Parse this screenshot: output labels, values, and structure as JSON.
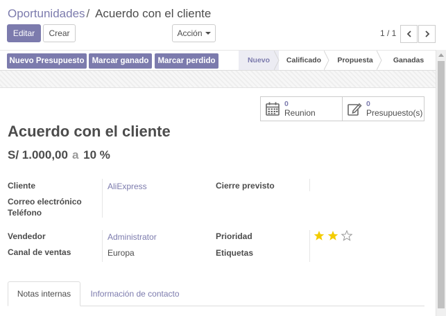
{
  "breadcrumb": {
    "parent": "Oportunidades",
    "separator": "/",
    "current": "Acuerdo con el cliente"
  },
  "toolbar": {
    "edit_label": "Editar",
    "create_label": "Crear",
    "action_label": "Acción"
  },
  "pager": {
    "value": "1 / 1"
  },
  "statusbar": {
    "buttons": [
      "Nuevo Presupuesto",
      "Marcar ganado",
      "Marcar perdido"
    ],
    "stages": [
      {
        "label": "Nuevo",
        "active": true
      },
      {
        "label": "Calificado",
        "active": false
      },
      {
        "label": "Propuesta",
        "active": false
      },
      {
        "label": "Ganadas",
        "active": false
      }
    ]
  },
  "smart_buttons": [
    {
      "count": "0",
      "label": "Reunion",
      "icon": "calendar-icon"
    },
    {
      "count": "0",
      "label": "Presupuesto(s)",
      "icon": "edit-icon"
    }
  ],
  "record": {
    "title": "Acuerdo con el cliente",
    "expected_revenue": "S/ 1.000,00",
    "at_label": "a",
    "probability": "10 %"
  },
  "fields": {
    "cliente": {
      "label": "Cliente",
      "value": "AliExpress"
    },
    "correo": {
      "label": "Correo electrónico",
      "value": ""
    },
    "telefono": {
      "label": "Teléfono",
      "value": ""
    },
    "cierre": {
      "label": "Cierre previsto",
      "value": ""
    },
    "vendedor": {
      "label": "Vendedor",
      "value": "Administrator"
    },
    "canal": {
      "label": "Canal de ventas",
      "value": "Europa"
    },
    "prioridad": {
      "label": "Prioridad",
      "stars_filled": 2,
      "stars_total": 3
    },
    "etiquetas": {
      "label": "Etiquetas",
      "value": ""
    }
  },
  "tabs": [
    {
      "label": "Notas internas",
      "active": true
    },
    {
      "label": "Información de contacto",
      "active": false
    }
  ],
  "colors": {
    "primary": "#7c7bad",
    "star": "#f3cc00",
    "text": "#4c4c4c"
  }
}
